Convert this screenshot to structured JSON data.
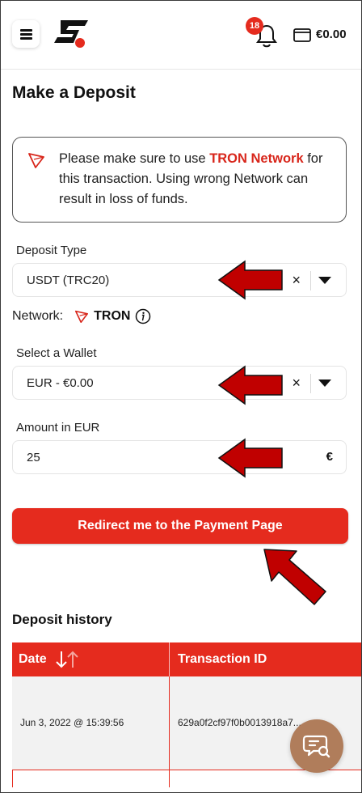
{
  "header": {
    "notification_count": "18",
    "balance": "€0.00"
  },
  "page": {
    "title": "Make a Deposit"
  },
  "notice": {
    "text_before": "Please make sure to use ",
    "highlight": "TRON Network",
    "text_after": " for this transaction. Using wrong Network can result in loss of funds."
  },
  "deposit_type": {
    "label": "Deposit Type",
    "value": "USDT (TRC20)",
    "clear": "×"
  },
  "network": {
    "label": "Network:",
    "name": "TRON"
  },
  "wallet": {
    "label": "Select a Wallet",
    "value": "EUR - €0.00",
    "clear": "×"
  },
  "amount": {
    "label": "Amount in EUR",
    "value": "25",
    "currency_symbol": "€"
  },
  "cta": {
    "label": "Redirect me to the Payment Page"
  },
  "history": {
    "title": "Deposit history",
    "columns": [
      "Date",
      "Transaction ID"
    ],
    "rows": [
      {
        "date": "Jun 3, 2022 @ 15:39:56",
        "transaction_id": "629a0f2cf97f0b0013918a7..."
      }
    ]
  },
  "colors": {
    "brand_red": "#e52b1e",
    "annotation_arrow": "#c00000",
    "chat_fab": "#b07d5b"
  },
  "icons": {
    "menu": "hamburger-icon",
    "logo": "brand-logo",
    "notifications": "bell-icon",
    "wallet": "wallet-icon",
    "tron": "tron-icon",
    "info": "info-icon",
    "sort": "sort-icon",
    "chat": "chat-search-icon"
  }
}
